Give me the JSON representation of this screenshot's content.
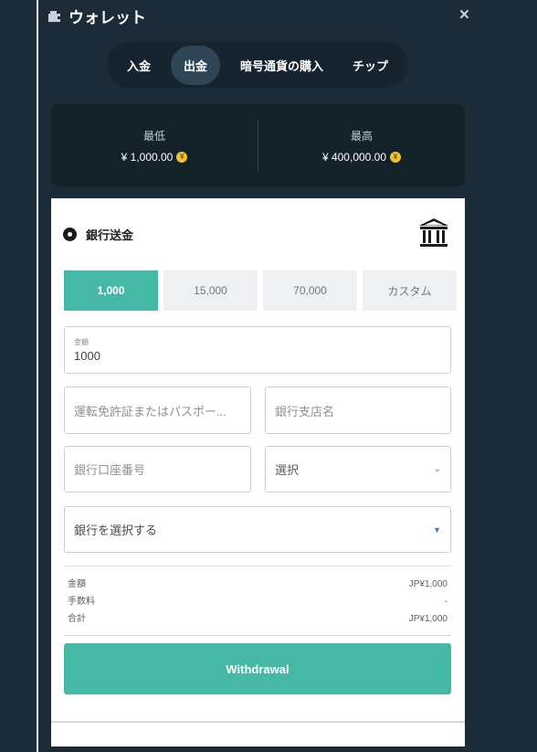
{
  "header": {
    "title": "ウォレット",
    "wallet_icon": "wallet-icon",
    "close_label": "×"
  },
  "tabs": [
    {
      "label": "入金",
      "active": false
    },
    {
      "label": "出金",
      "active": true
    },
    {
      "label": "暗号通貨の購入",
      "active": false
    },
    {
      "label": "チップ",
      "active": false
    }
  ],
  "limits": {
    "min_label": "最低",
    "min_value": "¥ 1,000.00",
    "max_label": "最高",
    "max_value": "¥ 400,000.00",
    "coin_icon": "yen-coin-icon",
    "coin_glyph": "¥"
  },
  "method": {
    "label": "銀行送金",
    "icon": "bank-icon"
  },
  "amount_options": [
    {
      "label": "1,000",
      "active": true
    },
    {
      "label": "15,000",
      "active": false
    },
    {
      "label": "70,000",
      "active": false
    },
    {
      "label": "カスタム",
      "active": false
    }
  ],
  "form": {
    "amount_label": "金額",
    "amount_value": "1000",
    "license_placeholder": "運転免許証またはパスポー...",
    "branch_placeholder": "銀行支店名",
    "account_placeholder": "銀行口座番号",
    "select_value": "選択",
    "bank_placeholder": "銀行を選択する"
  },
  "summary": {
    "amount_label": "金額",
    "amount_value": "JP¥1,000",
    "fee_label": "手数料",
    "fee_value": "-",
    "total_label": "合計",
    "total_value": "JP¥1,000"
  },
  "withdraw_label": "Withdrawal",
  "colors": {
    "accent": "#45b8a6",
    "background": "#1b2b37",
    "panel": "#ffffff"
  }
}
